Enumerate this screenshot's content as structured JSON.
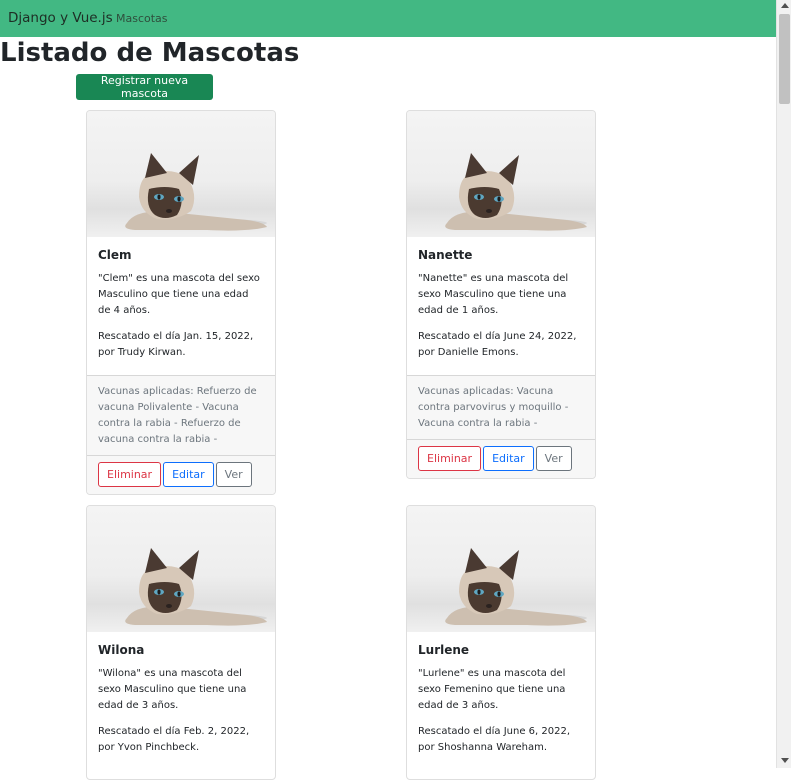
{
  "navbar": {
    "brand": "Django y Vue.js",
    "link": "Mascotas"
  },
  "page": {
    "title": "Listado de Mascotas",
    "new_button": "Registrar nueva mascota"
  },
  "colors": {
    "navbar": "#42b883",
    "primary_button": "#198754",
    "danger": "#dc3545",
    "info": "#0d6efd",
    "secondary": "#6c757d"
  },
  "cards": [
    {
      "name": "Clem",
      "desc": "\"Clem\" es una mascota del sexo Masculino que tiene una edad de 4 años.",
      "rescue": "Rescatado el día Jan. 15, 2022, por Trudy Kirwan.",
      "vaccines": "Vacunas aplicadas: Refuerzo de vacuna Polivalente - Vacuna contra la rabia - Refuerzo de vacuna contra la rabia -",
      "delete": "Eliminar",
      "edit": "Editar",
      "view": "Ver"
    },
    {
      "name": "Nanette",
      "desc": "\"Nanette\" es una mascota del sexo Masculino que tiene una edad de 1 años.",
      "rescue": "Rescatado el día June 24, 2022, por Danielle Emons.",
      "vaccines": "Vacunas aplicadas: Vacuna contra parvovirus y moquillo - Vacuna contra la rabia -",
      "delete": "Eliminar",
      "edit": "Editar",
      "view": "Ver"
    },
    {
      "name": "Wilona",
      "desc": "\"Wilona\" es una mascota del sexo Masculino que tiene una edad de 3 años.",
      "rescue": "Rescatado el día Feb. 2, 2022, por Yvon Pinchbeck."
    },
    {
      "name": "Lurlene",
      "desc": "\"Lurlene\" es una mascota del sexo Femenino que tiene una edad de 3 años.",
      "rescue": "Rescatado el día June 6, 2022, por Shoshanna Wareham."
    }
  ]
}
